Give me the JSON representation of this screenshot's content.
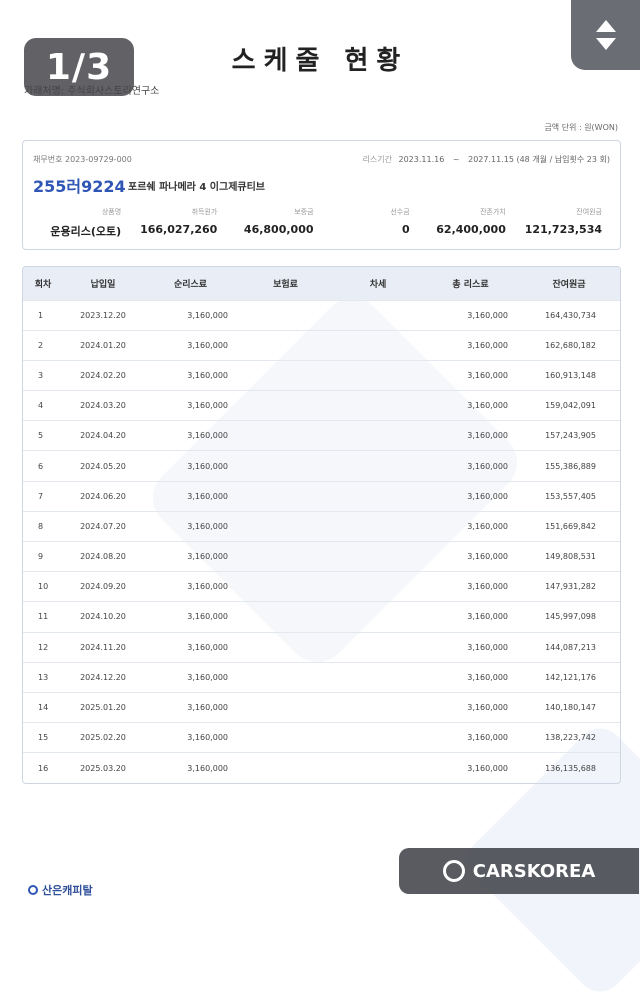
{
  "header": {
    "page_indicator": "1/3",
    "title": "스케줄 현황",
    "company": "가래처명: 주식회사스토리연구소"
  },
  "unit_label": "금액 단위 : 원(WON)",
  "summary": {
    "contract_no": "채무번호 2023-09729-000",
    "period_label": "리스기간",
    "period_start": "2023.11.16",
    "period_end": "2027.11.15",
    "period_note": "(48 개월 / 납입횟수 23 회)",
    "plate": "255러9224",
    "vehicle": "포르쉐 파나메라 4 이그제큐티브",
    "fields": [
      {
        "label": "상품명",
        "value": "운용리스(오토)"
      },
      {
        "label": "취득원가",
        "value": "166,027,260"
      },
      {
        "label": "보증금",
        "value": "46,800,000"
      },
      {
        "label": "선수금",
        "value": "0"
      },
      {
        "label": "잔존가치",
        "value": "62,400,000"
      },
      {
        "label": "잔여원금",
        "value": "121,723,534"
      }
    ]
  },
  "table": {
    "headers": [
      "회차",
      "납입일",
      "순리스료",
      "보험료",
      "차세",
      "총 리스료",
      "잔여원금"
    ],
    "rows": [
      [
        "1",
        "2023.12.20",
        "3,160,000",
        "",
        "",
        "3,160,000",
        "164,430,734"
      ],
      [
        "2",
        "2024.01.20",
        "3,160,000",
        "",
        "",
        "3,160,000",
        "162,680,182"
      ],
      [
        "3",
        "2024.02.20",
        "3,160,000",
        "",
        "",
        "3,160,000",
        "160,913,148"
      ],
      [
        "4",
        "2024.03.20",
        "3,160,000",
        "",
        "",
        "3,160,000",
        "159,042,091"
      ],
      [
        "5",
        "2024.04.20",
        "3,160,000",
        "",
        "",
        "3,160,000",
        "157,243,905"
      ],
      [
        "6",
        "2024.05.20",
        "3,160,000",
        "",
        "",
        "3,160,000",
        "155,386,889"
      ],
      [
        "7",
        "2024.06.20",
        "3,160,000",
        "",
        "",
        "3,160,000",
        "153,557,405"
      ],
      [
        "8",
        "2024.07.20",
        "3,160,000",
        "",
        "",
        "3,160,000",
        "151,669,842"
      ],
      [
        "9",
        "2024.08.20",
        "3,160,000",
        "",
        "",
        "3,160,000",
        "149,808,531"
      ],
      [
        "10",
        "2024.09.20",
        "3,160,000",
        "",
        "",
        "3,160,000",
        "147,931,282"
      ],
      [
        "11",
        "2024.10.20",
        "3,160,000",
        "",
        "",
        "3,160,000",
        "145,997,098"
      ],
      [
        "12",
        "2024.11.20",
        "3,160,000",
        "",
        "",
        "3,160,000",
        "144,087,213"
      ],
      [
        "13",
        "2024.12.20",
        "3,160,000",
        "",
        "",
        "3,160,000",
        "142,121,176"
      ],
      [
        "14",
        "2025.01.20",
        "3,160,000",
        "",
        "",
        "3,160,000",
        "140,180,147"
      ],
      [
        "15",
        "2025.02.20",
        "3,160,000",
        "",
        "",
        "3,160,000",
        "138,223,742"
      ],
      [
        "16",
        "2025.03.20",
        "3,160,000",
        "",
        "",
        "3,160,000",
        "136,135,688"
      ]
    ]
  },
  "footer": {
    "lender_logo": "산은캐피탈",
    "watermark": "CARSKOREA"
  },
  "colors": {
    "accent": "#2f55b5",
    "table_header_bg": "#e9eef6",
    "border": "#cfd6e2"
  },
  "icons": {
    "nav": [
      "chevron-up-icon",
      "chevron-down-icon"
    ]
  }
}
